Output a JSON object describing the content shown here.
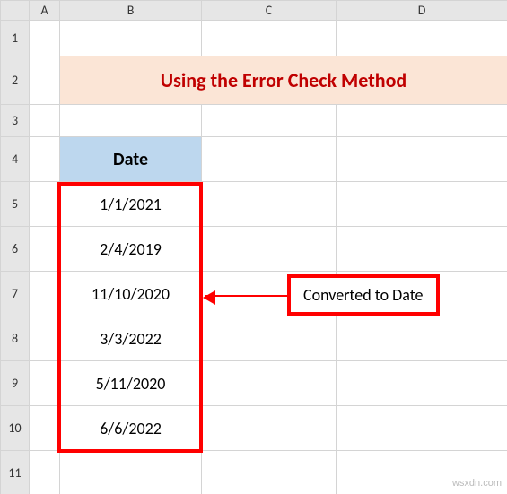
{
  "columns": {
    "A": "A",
    "B": "B",
    "C": "C",
    "D": "D"
  },
  "rows": [
    "1",
    "2",
    "3",
    "4",
    "5",
    "6",
    "7",
    "8",
    "9",
    "10",
    "11"
  ],
  "title": "Using the Error Check Method",
  "table": {
    "header": "Date",
    "values": [
      "1/1/2021",
      "2/4/2019",
      "11/10/2020",
      "3/3/2022",
      "5/11/2020",
      "6/6/2022"
    ]
  },
  "callout": "Converted to Date",
  "watermark": "wsxdn.com"
}
